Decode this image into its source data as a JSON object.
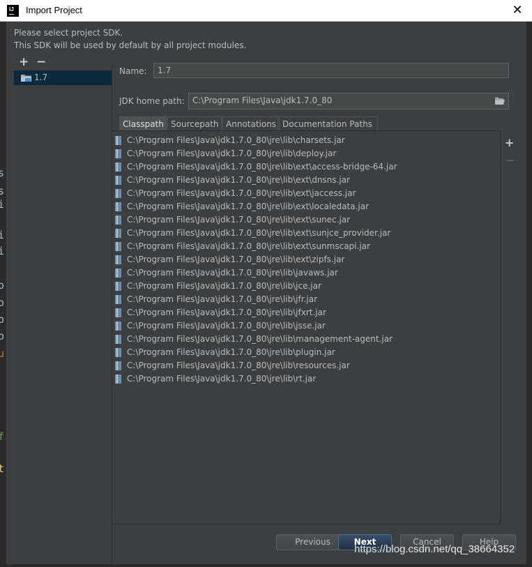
{
  "window": {
    "title": "Import Project",
    "app_icon_text": "IJ",
    "close_glyph": "✕"
  },
  "description": {
    "line1": "Please select project SDK.",
    "line2": "This SDK will be used by default by all project modules."
  },
  "sdk_toolbar": {
    "add": "+",
    "remove": "−"
  },
  "sdk_list": [
    {
      "label": "1.7",
      "selected": true,
      "icon": "jdk-folder-icon"
    }
  ],
  "form": {
    "name_label": "Name:",
    "name_value": "1.7",
    "jdk_home_label": "JDK home path:",
    "jdk_home_value": "C:\\Program Files\\Java\\jdk1.7.0_80",
    "browse_icon": "folder-open-icon"
  },
  "tabs": [
    {
      "label": "Classpath",
      "active": true
    },
    {
      "label": "Sourcepath",
      "active": false
    },
    {
      "label": "Annotations",
      "active": false
    },
    {
      "label": "Documentation Paths",
      "active": false
    }
  ],
  "classpath_toolbar": {
    "add": "+",
    "remove": "−"
  },
  "classpath": [
    "C:\\Program Files\\Java\\jdk1.7.0_80\\jre\\lib\\charsets.jar",
    "C:\\Program Files\\Java\\jdk1.7.0_80\\jre\\lib\\deploy.jar",
    "C:\\Program Files\\Java\\jdk1.7.0_80\\jre\\lib\\ext\\access-bridge-64.jar",
    "C:\\Program Files\\Java\\jdk1.7.0_80\\jre\\lib\\ext\\dnsns.jar",
    "C:\\Program Files\\Java\\jdk1.7.0_80\\jre\\lib\\ext\\jaccess.jar",
    "C:\\Program Files\\Java\\jdk1.7.0_80\\jre\\lib\\ext\\localedata.jar",
    "C:\\Program Files\\Java\\jdk1.7.0_80\\jre\\lib\\ext\\sunec.jar",
    "C:\\Program Files\\Java\\jdk1.7.0_80\\jre\\lib\\ext\\sunjce_provider.jar",
    "C:\\Program Files\\Java\\jdk1.7.0_80\\jre\\lib\\ext\\sunmscapi.jar",
    "C:\\Program Files\\Java\\jdk1.7.0_80\\jre\\lib\\ext\\zipfs.jar",
    "C:\\Program Files\\Java\\jdk1.7.0_80\\jre\\lib\\javaws.jar",
    "C:\\Program Files\\Java\\jdk1.7.0_80\\jre\\lib\\jce.jar",
    "C:\\Program Files\\Java\\jdk1.7.0_80\\jre\\lib\\jfr.jar",
    "C:\\Program Files\\Java\\jdk1.7.0_80\\jre\\lib\\jfxrt.jar",
    "C:\\Program Files\\Java\\jdk1.7.0_80\\jre\\lib\\jsse.jar",
    "C:\\Program Files\\Java\\jdk1.7.0_80\\jre\\lib\\management-agent.jar",
    "C:\\Program Files\\Java\\jdk1.7.0_80\\jre\\lib\\plugin.jar",
    "C:\\Program Files\\Java\\jdk1.7.0_80\\jre\\lib\\resources.jar",
    "C:\\Program Files\\Java\\jdk1.7.0_80\\jre\\lib\\rt.jar"
  ],
  "footer": {
    "previous": "Previous",
    "next": "Next",
    "cancel": "Cancel",
    "help": "Help"
  },
  "watermark": "https://blog.csdn.net/qq_38664352",
  "background_editor_glyphs": [
    "s",
    "s",
    "i",
    "i",
    "i",
    "o",
    "o",
    "o",
    "o",
    "u",
    "f",
    "t"
  ],
  "colors": {
    "dialog_bg": "#3c3f41",
    "selection_bg": "#0d293e",
    "input_bg": "#45494a",
    "default_button": "#365880"
  }
}
